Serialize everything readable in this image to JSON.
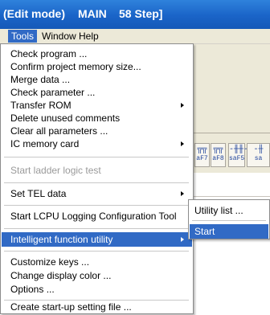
{
  "window": {
    "title_parts": [
      "(Edit mode)",
      "MAIN",
      "58 Step]"
    ]
  },
  "menubar": {
    "items": [
      {
        "label": "Tools",
        "active": true
      },
      {
        "label": "Window",
        "active": false
      },
      {
        "label": "Help",
        "active": false
      }
    ]
  },
  "ladder_toolbar": {
    "buttons": [
      {
        "glyph": "╦╦",
        "label": "aF7"
      },
      {
        "glyph": "╦╦",
        "label": "aF8"
      },
      {
        "glyph": "-╫╫-",
        "label": "saF5"
      },
      {
        "glyph": "-╫",
        "label": "sa"
      }
    ]
  },
  "tools_menu": {
    "items": [
      {
        "label": "Check program ...",
        "enabled": true,
        "submenu": false
      },
      {
        "label": "Confirm project memory size...",
        "enabled": true,
        "submenu": false
      },
      {
        "label": "Merge data ...",
        "enabled": true,
        "submenu": false
      },
      {
        "label": "Check parameter ...",
        "enabled": true,
        "submenu": false
      },
      {
        "label": "Transfer ROM",
        "enabled": true,
        "submenu": true
      },
      {
        "label": "Delete unused comments",
        "enabled": true,
        "submenu": false
      },
      {
        "label": "Clear all parameters ...",
        "enabled": true,
        "submenu": false
      },
      {
        "label": "IC memory card",
        "enabled": true,
        "submenu": true
      },
      {
        "label": "Start ladder logic test",
        "enabled": false,
        "submenu": false
      },
      {
        "label": "Set TEL data",
        "enabled": true,
        "submenu": true
      },
      {
        "label": "Start LCPU Logging Configuration Tool",
        "enabled": true,
        "submenu": false
      },
      {
        "label": "Intelligent function utility",
        "enabled": true,
        "submenu": true,
        "highlighted": true
      },
      {
        "label": "Customize keys ...",
        "enabled": true,
        "submenu": false
      },
      {
        "label": "Change display color ...",
        "enabled": true,
        "submenu": false
      },
      {
        "label": "Options ...",
        "enabled": true,
        "submenu": false
      },
      {
        "label": "Create start-up setting file ...",
        "enabled": true,
        "submenu": false
      }
    ]
  },
  "intelligent_function_submenu": {
    "items": [
      {
        "label": "Utility list ...",
        "highlighted": false
      },
      {
        "label": "Start",
        "highlighted": true
      }
    ]
  },
  "colors": {
    "titlebar": "#1a64c8",
    "highlight": "#316ac5",
    "menubar": "#ece9d8",
    "disabled_text": "#9a9a9a"
  }
}
